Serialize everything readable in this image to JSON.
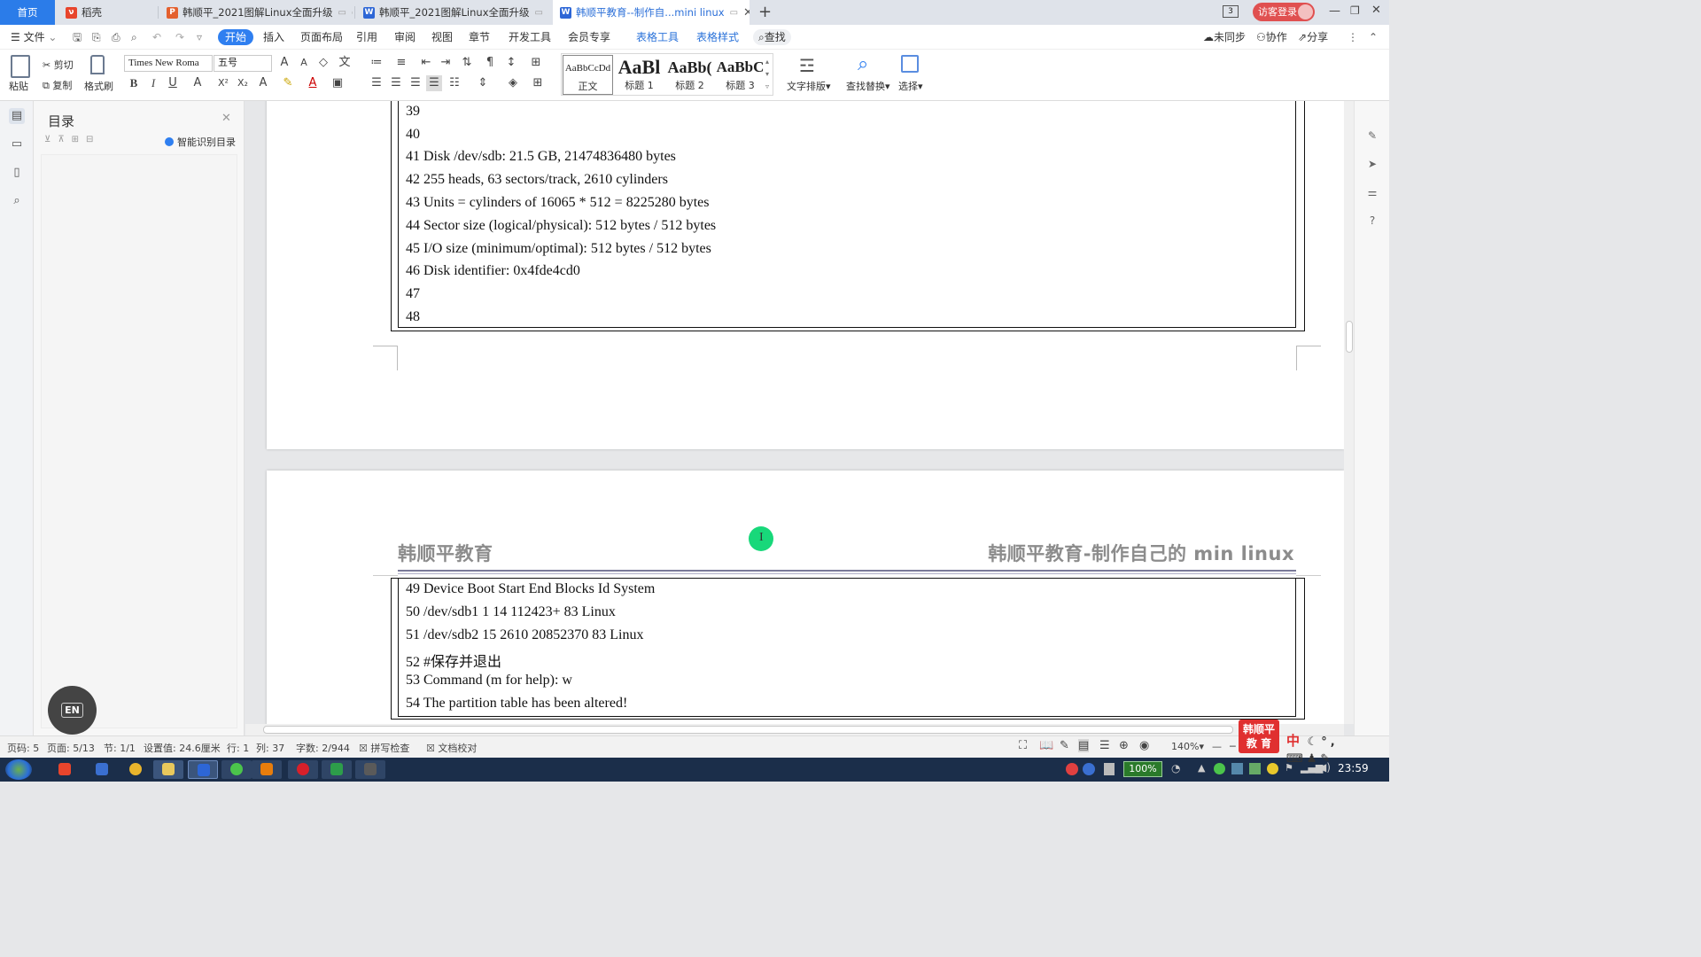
{
  "tabs": [
    {
      "label": "首页"
    },
    {
      "label": "稻壳"
    },
    {
      "label": "韩顺平_2021图解Linux全面升级"
    },
    {
      "label": "韩顺平_2021图解Linux全面升级"
    },
    {
      "label": "韩顺平教育--制作自...mini linux"
    }
  ],
  "window": {
    "badge": "3",
    "login": "访客登录"
  },
  "menu": {
    "file": "文件",
    "items": [
      "开始",
      "插入",
      "页面布局",
      "引用",
      "审阅",
      "视图",
      "章节",
      "开发工具",
      "会员专享"
    ],
    "table_tools": "表格工具",
    "table_style": "表格样式",
    "search": "查找",
    "sync": "未同步",
    "collab": "协作",
    "share": "分享"
  },
  "ribbon": {
    "paste": "粘贴",
    "cut": "剪切",
    "copy": "复制",
    "format_painter": "格式刷",
    "font": "Times New Roma",
    "size": "五号",
    "styles": [
      {
        "preview": "AaBbCcDd",
        "name": "正文"
      },
      {
        "preview": "AaBl",
        "name": "标题 1"
      },
      {
        "preview": "AaBb(",
        "name": "标题 2"
      },
      {
        "preview": "AaBbC",
        "name": "标题 3"
      }
    ],
    "text_layout": "文字排版",
    "find_replace": "查找替换",
    "select": "选择"
  },
  "toc": {
    "title": "目录",
    "smart": "智能识别目录"
  },
  "doc": {
    "page1_lines": [
      "39",
      "40",
      "41 Disk /dev/sdb: 21.5 GB, 21474836480 bytes",
      "42 255 heads, 63 sectors/track, 2610 cylinders",
      "43 Units = cylinders of 16065 * 512 = 8225280 bytes",
      "44 Sector size (logical/physical): 512 bytes / 512 bytes",
      "45 I/O size (minimum/optimal): 512 bytes / 512 bytes",
      "46 Disk identifier: 0x4fde4cd0",
      "47",
      "48"
    ],
    "header_left": "韩顺平教育",
    "header_right": "韩顺平教育-制作自己的 min linux",
    "page2_lines": [
      "49 Device Boot Start End Blocks Id System",
      "50 /dev/sdb1 1 14 112423+ 83 Linux",
      "51 /dev/sdb2 15 2610 20852370 83 Linux",
      "52 #保存并退出",
      "53 Command (m for help): w",
      "54 The partition table has been altered!"
    ]
  },
  "status": {
    "pageno": "页码: 5",
    "pages": "页面: 5/13",
    "section": "节: 1/1",
    "setting": "设置值: 24.6厘米",
    "row": "行: 1",
    "col": "列: 37",
    "words": "字数: 2/944",
    "spell": "拼写检查",
    "proof": "文档校对",
    "zoom": "140%"
  },
  "overlays": {
    "en": "EN",
    "brand": "韩顺平教 育",
    "ime": "中"
  },
  "taskbar": {
    "battery": "100%",
    "clock": "23:59"
  },
  "colors": {
    "accent": "#2f7ff0",
    "tab_bg": "#dfe3ea",
    "brand": "#e03030"
  }
}
